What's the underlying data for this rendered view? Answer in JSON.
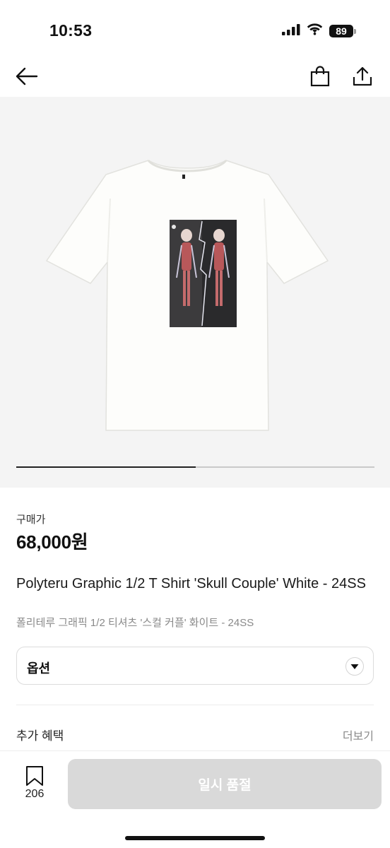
{
  "status_bar": {
    "time": "10:53",
    "battery": "89",
    "icons": [
      "signal-icon",
      "wifi-icon",
      "battery-icon"
    ]
  },
  "nav": {
    "icons": [
      "back-arrow-icon",
      "shopping-bag-icon",
      "share-icon"
    ]
  },
  "carousel": {
    "current_index": 1,
    "total": 2,
    "progress_fraction": 0.5
  },
  "product": {
    "price_label": "구매가",
    "price": "68,000원",
    "name_en": "Polyteru Graphic 1/2 T Shirt 'Skull Couple' White - 24SS",
    "name_ko": "폴리테루 그래픽 1/2 티셔츠 '스컬 커플' 화이트 - 24SS"
  },
  "option": {
    "label": "옵션",
    "icon": "chevron-down-icon"
  },
  "benefits": {
    "label": "추가 혜택",
    "more": "더보기"
  },
  "bottom": {
    "bookmark_count": "206",
    "button_label": "일시 품절",
    "button_color": "#d9d9d9"
  }
}
